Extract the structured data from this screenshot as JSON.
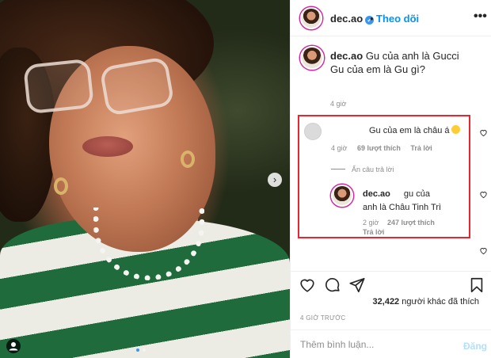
{
  "post": {
    "username": "dec.ao",
    "follow_label": "Theo dõi",
    "more_label": "•••",
    "verified_mark": "✓",
    "caption_username": "dec.ao",
    "caption_line1": "Gu của anh là Gucci",
    "caption_line2": "Gu của em là Gu gì?",
    "caption_time": "4 giờ",
    "photo_page": 1,
    "photo_count": 2,
    "next_arrow": "›"
  },
  "comments": [
    {
      "text": "Gu của em là châu á",
      "emoji": "smirk-emoji",
      "time": "4 giờ",
      "likes": "69 lượt thích",
      "reply_label": "Trả lời",
      "hide_replies_label": "Ẩn câu trả lời",
      "replies": [
        {
          "username": "dec.ao",
          "text_part1": "gu của",
          "text_part2": "anh là Châu Tinh Trì",
          "time": "2 giờ",
          "likes": "247 lượt thích",
          "reply_label": "Trả lời"
        }
      ]
    }
  ],
  "engagement": {
    "likes_count": "32,422",
    "likes_suffix": "người khác đã thích",
    "time_ago": "4 GIỜ TRƯỚC"
  },
  "composer": {
    "placeholder": "Thêm bình luận...",
    "post_label": "Đăng"
  },
  "icons": {
    "like": "heart-outline",
    "comment": "speech-bubble",
    "share": "paper-plane",
    "save": "bookmark",
    "tag": "user-tag"
  },
  "colors": {
    "accent_blue": "#0095f6",
    "highlight_box": "#e8262f",
    "muted_text": "#8e8e8e",
    "post_disabled": "#b2dffc"
  }
}
